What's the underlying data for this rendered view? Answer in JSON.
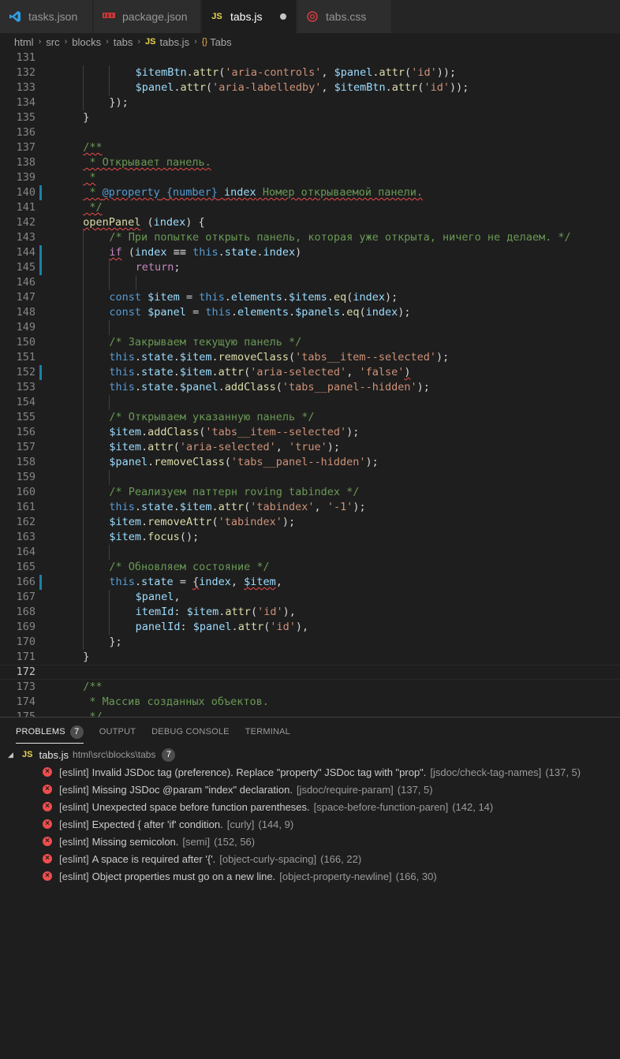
{
  "tabs": [
    {
      "label": "tasks.json",
      "icon": "vscode-icon",
      "color": "#2f9fe4"
    },
    {
      "label": "package.json",
      "icon": "npm-icon",
      "color": "#cb3837"
    },
    {
      "label": "tabs.js",
      "icon": "js-icon",
      "icon_text": "JS",
      "color": "#e8d44d",
      "active": true,
      "modified": true
    },
    {
      "label": "tabs.css",
      "icon": "css-icon",
      "color": "#cc3e44"
    }
  ],
  "breadcrumb": {
    "items": [
      "html",
      "src",
      "blocks",
      "tabs"
    ],
    "file": "tabs.js",
    "file_icon": "JS",
    "symbol": "Tabs",
    "symbol_icon": "{}"
  },
  "editor": {
    "lines": [
      {
        "n": "131",
        "i": 0,
        "t": [
          [
            "",
            ""
          ]
        ]
      },
      {
        "n": "132",
        "i": 3,
        "t": [
          [
            "vr",
            "$itemBtn"
          ],
          [
            "pl",
            "."
          ],
          [
            "fn",
            "attr"
          ],
          [
            "pl",
            "("
          ],
          [
            "st",
            "'aria-controls'"
          ],
          [
            "pl",
            ", "
          ],
          [
            "vr",
            "$panel"
          ],
          [
            "pl",
            "."
          ],
          [
            "fn",
            "attr"
          ],
          [
            "pl",
            "("
          ],
          [
            "st",
            "'id'"
          ],
          [
            "pl",
            "));"
          ]
        ]
      },
      {
        "n": "133",
        "i": 3,
        "t": [
          [
            "vr",
            "$panel"
          ],
          [
            "pl",
            "."
          ],
          [
            "fn",
            "attr"
          ],
          [
            "pl",
            "("
          ],
          [
            "st",
            "'aria-labelledby'"
          ],
          [
            "pl",
            ", "
          ],
          [
            "vr",
            "$itemBtn"
          ],
          [
            "pl",
            "."
          ],
          [
            "fn",
            "attr"
          ],
          [
            "pl",
            "("
          ],
          [
            "st",
            "'id'"
          ],
          [
            "pl",
            "));"
          ]
        ]
      },
      {
        "n": "134",
        "i": 2,
        "t": [
          [
            "pl",
            "});"
          ]
        ]
      },
      {
        "n": "135",
        "i": 1,
        "t": [
          [
            "pl",
            "}"
          ]
        ]
      },
      {
        "n": "136",
        "i": 0,
        "t": [
          [
            "",
            ""
          ]
        ]
      },
      {
        "n": "137",
        "i": 1,
        "t": [
          [
            "cm wv",
            "/**"
          ]
        ]
      },
      {
        "n": "138",
        "i": 1,
        "t": [
          [
            "cm wv",
            " * Открывает панель."
          ]
        ]
      },
      {
        "n": "139",
        "i": 1,
        "t": [
          [
            "cm wv",
            " *"
          ]
        ]
      },
      {
        "n": "140",
        "i": 1,
        "g": true,
        "t": [
          [
            "cm wv",
            " * "
          ],
          [
            "tg wv",
            "@property"
          ],
          [
            "cm wv",
            " "
          ],
          [
            "tg wv",
            "{number}"
          ],
          [
            "cm wv",
            " "
          ],
          [
            "vr wv",
            "index"
          ],
          [
            "cm wv",
            " Номер открываемой панели."
          ]
        ]
      },
      {
        "n": "141",
        "i": 1,
        "t": [
          [
            "cm wv",
            " */"
          ]
        ]
      },
      {
        "n": "142",
        "i": 1,
        "t": [
          [
            "fn wv",
            "openPanel"
          ],
          [
            "pl",
            " ("
          ],
          [
            "vr",
            "index"
          ],
          [
            "pl",
            ") {"
          ]
        ]
      },
      {
        "n": "143",
        "i": 2,
        "t": [
          [
            "cm",
            "/* При попытке открыть панель, которая уже открыта, ничего не делаем. */"
          ]
        ]
      },
      {
        "n": "144",
        "i": 2,
        "g": true,
        "t": [
          [
            "ctl wv",
            "if"
          ],
          [
            "pl",
            " ("
          ],
          [
            "vr",
            "index"
          ],
          [
            "pl",
            " ≡≡ "
          ],
          [
            "kw",
            "this"
          ],
          [
            "pl",
            "."
          ],
          [
            "vr",
            "state"
          ],
          [
            "pl",
            "."
          ],
          [
            "vr",
            "index"
          ],
          [
            "pl",
            ")"
          ]
        ]
      },
      {
        "n": "145",
        "i": 3,
        "g": true,
        "t": [
          [
            "ctl",
            "return"
          ],
          [
            "pl",
            ";"
          ]
        ]
      },
      {
        "n": "146",
        "i": 3,
        "t": [
          [
            "",
            ""
          ]
        ]
      },
      {
        "n": "147",
        "i": 2,
        "t": [
          [
            "kw",
            "const"
          ],
          [
            "pl",
            " "
          ],
          [
            "vr",
            "$item"
          ],
          [
            "pl",
            " = "
          ],
          [
            "kw",
            "this"
          ],
          [
            "pl",
            "."
          ],
          [
            "vr",
            "elements"
          ],
          [
            "pl",
            "."
          ],
          [
            "vr",
            "$items"
          ],
          [
            "pl",
            "."
          ],
          [
            "fn",
            "eq"
          ],
          [
            "pl",
            "("
          ],
          [
            "vr",
            "index"
          ],
          [
            "pl",
            ");"
          ]
        ]
      },
      {
        "n": "148",
        "i": 2,
        "t": [
          [
            "kw",
            "const"
          ],
          [
            "pl",
            " "
          ],
          [
            "vr",
            "$panel"
          ],
          [
            "pl",
            " = "
          ],
          [
            "kw",
            "this"
          ],
          [
            "pl",
            "."
          ],
          [
            "vr",
            "elements"
          ],
          [
            "pl",
            "."
          ],
          [
            "vr",
            "$panels"
          ],
          [
            "pl",
            "."
          ],
          [
            "fn",
            "eq"
          ],
          [
            "pl",
            "("
          ],
          [
            "vr",
            "index"
          ],
          [
            "pl",
            ");"
          ]
        ]
      },
      {
        "n": "149",
        "i": 2,
        "t": [
          [
            "",
            ""
          ]
        ]
      },
      {
        "n": "150",
        "i": 2,
        "t": [
          [
            "cm",
            "/* Закрываем текущую панель */"
          ]
        ]
      },
      {
        "n": "151",
        "i": 2,
        "t": [
          [
            "kw",
            "this"
          ],
          [
            "pl",
            "."
          ],
          [
            "vr",
            "state"
          ],
          [
            "pl",
            "."
          ],
          [
            "vr",
            "$item"
          ],
          [
            "pl",
            "."
          ],
          [
            "fn",
            "removeClass"
          ],
          [
            "pl",
            "("
          ],
          [
            "st",
            "'tabs__item--selected'"
          ],
          [
            "pl",
            ");"
          ]
        ]
      },
      {
        "n": "152",
        "i": 2,
        "g": true,
        "t": [
          [
            "kw",
            "this"
          ],
          [
            "pl",
            "."
          ],
          [
            "vr",
            "state"
          ],
          [
            "pl",
            "."
          ],
          [
            "vr",
            "$item"
          ],
          [
            "pl",
            "."
          ],
          [
            "fn",
            "attr"
          ],
          [
            "pl",
            "("
          ],
          [
            "st",
            "'aria-selected'"
          ],
          [
            "pl",
            ", "
          ],
          [
            "st",
            "'false'"
          ],
          [
            "pl wv",
            ")"
          ]
        ]
      },
      {
        "n": "153",
        "i": 2,
        "t": [
          [
            "kw",
            "this"
          ],
          [
            "pl",
            "."
          ],
          [
            "vr",
            "state"
          ],
          [
            "pl",
            "."
          ],
          [
            "vr",
            "$panel"
          ],
          [
            "pl",
            "."
          ],
          [
            "fn",
            "addClass"
          ],
          [
            "pl",
            "("
          ],
          [
            "st",
            "'tabs__panel--hidden'"
          ],
          [
            "pl",
            ");"
          ]
        ]
      },
      {
        "n": "154",
        "i": 2,
        "t": [
          [
            "",
            ""
          ]
        ]
      },
      {
        "n": "155",
        "i": 2,
        "t": [
          [
            "cm",
            "/* Открываем указанную панель */"
          ]
        ]
      },
      {
        "n": "156",
        "i": 2,
        "t": [
          [
            "vr",
            "$item"
          ],
          [
            "pl",
            "."
          ],
          [
            "fn",
            "addClass"
          ],
          [
            "pl",
            "("
          ],
          [
            "st",
            "'tabs__item--selected'"
          ],
          [
            "pl",
            ");"
          ]
        ]
      },
      {
        "n": "157",
        "i": 2,
        "t": [
          [
            "vr",
            "$item"
          ],
          [
            "pl",
            "."
          ],
          [
            "fn",
            "attr"
          ],
          [
            "pl",
            "("
          ],
          [
            "st",
            "'aria-selected'"
          ],
          [
            "pl",
            ", "
          ],
          [
            "st",
            "'true'"
          ],
          [
            "pl",
            ");"
          ]
        ]
      },
      {
        "n": "158",
        "i": 2,
        "t": [
          [
            "vr",
            "$panel"
          ],
          [
            "pl",
            "."
          ],
          [
            "fn",
            "removeClass"
          ],
          [
            "pl",
            "("
          ],
          [
            "st",
            "'tabs__panel--hidden'"
          ],
          [
            "pl",
            ");"
          ]
        ]
      },
      {
        "n": "159",
        "i": 2,
        "t": [
          [
            "",
            ""
          ]
        ]
      },
      {
        "n": "160",
        "i": 2,
        "t": [
          [
            "cm",
            "/* Реализуем паттерн roving tabindex */"
          ]
        ]
      },
      {
        "n": "161",
        "i": 2,
        "t": [
          [
            "kw",
            "this"
          ],
          [
            "pl",
            "."
          ],
          [
            "vr",
            "state"
          ],
          [
            "pl",
            "."
          ],
          [
            "vr",
            "$item"
          ],
          [
            "pl",
            "."
          ],
          [
            "fn",
            "attr"
          ],
          [
            "pl",
            "("
          ],
          [
            "st",
            "'tabindex'"
          ],
          [
            "pl",
            ", "
          ],
          [
            "st",
            "'-1'"
          ],
          [
            "pl",
            ");"
          ]
        ]
      },
      {
        "n": "162",
        "i": 2,
        "t": [
          [
            "vr",
            "$item"
          ],
          [
            "pl",
            "."
          ],
          [
            "fn",
            "removeAttr"
          ],
          [
            "pl",
            "("
          ],
          [
            "st",
            "'tabindex'"
          ],
          [
            "pl",
            ");"
          ]
        ]
      },
      {
        "n": "163",
        "i": 2,
        "t": [
          [
            "vr",
            "$item"
          ],
          [
            "pl",
            "."
          ],
          [
            "fn",
            "focus"
          ],
          [
            "pl",
            "();"
          ]
        ]
      },
      {
        "n": "164",
        "i": 2,
        "t": [
          [
            "",
            ""
          ]
        ]
      },
      {
        "n": "165",
        "i": 2,
        "t": [
          [
            "cm",
            "/* Обновляем состояние */"
          ]
        ]
      },
      {
        "n": "166",
        "i": 2,
        "g": true,
        "t": [
          [
            "kw",
            "this"
          ],
          [
            "pl",
            "."
          ],
          [
            "vr",
            "state"
          ],
          [
            "pl",
            " = "
          ],
          [
            "pl wv",
            "{"
          ],
          [
            "vr",
            "index"
          ],
          [
            "pl",
            ", "
          ],
          [
            "vr wv",
            "$item"
          ],
          [
            "pl",
            ","
          ]
        ]
      },
      {
        "n": "167",
        "i": 3,
        "t": [
          [
            "vr",
            "$panel"
          ],
          [
            "pl",
            ","
          ]
        ]
      },
      {
        "n": "168",
        "i": 3,
        "t": [
          [
            "vr",
            "itemId"
          ],
          [
            "pl",
            ": "
          ],
          [
            "vr",
            "$item"
          ],
          [
            "pl",
            "."
          ],
          [
            "fn",
            "attr"
          ],
          [
            "pl",
            "("
          ],
          [
            "st",
            "'id'"
          ],
          [
            "pl",
            "),"
          ]
        ]
      },
      {
        "n": "169",
        "i": 3,
        "t": [
          [
            "vr",
            "panelId"
          ],
          [
            "pl",
            ": "
          ],
          [
            "vr",
            "$panel"
          ],
          [
            "pl",
            "."
          ],
          [
            "fn",
            "attr"
          ],
          [
            "pl",
            "("
          ],
          [
            "st",
            "'id'"
          ],
          [
            "pl",
            "),"
          ]
        ]
      },
      {
        "n": "170",
        "i": 2,
        "t": [
          [
            "pl",
            "};"
          ]
        ]
      },
      {
        "n": "171",
        "i": 1,
        "t": [
          [
            "pl",
            "}"
          ]
        ]
      },
      {
        "n": "172",
        "i": 0,
        "current": true,
        "t": [
          [
            "",
            ""
          ]
        ]
      },
      {
        "n": "173",
        "i": 1,
        "t": [
          [
            "cm",
            "/**"
          ]
        ]
      },
      {
        "n": "174",
        "i": 1,
        "t": [
          [
            "cm",
            " * Массив созданных объектов."
          ]
        ]
      },
      {
        "n": "175",
        "i": 1,
        "t": [
          [
            "cm",
            " */"
          ]
        ]
      }
    ]
  },
  "panel": {
    "tabs": [
      {
        "label": "PROBLEMS",
        "active": true,
        "badge": "7"
      },
      {
        "label": "OUTPUT"
      },
      {
        "label": "DEBUG CONSOLE"
      },
      {
        "label": "TERMINAL"
      }
    ],
    "file": {
      "icon": "JS",
      "name": "tabs.js",
      "path": "html\\src\\blocks\\tabs",
      "count": "7"
    },
    "problems": [
      {
        "source": "[eslint]",
        "message": "Invalid JSDoc tag (preference). Replace \"property\" JSDoc tag with \"prop\".",
        "rule": "[jsdoc/check-tag-names]",
        "location": "(137, 5)"
      },
      {
        "source": "[eslint]",
        "message": "Missing JSDoc @param \"index\" declaration.",
        "rule": "[jsdoc/require-param]",
        "location": "(137, 5)"
      },
      {
        "source": "[eslint]",
        "message": "Unexpected space before function parentheses.",
        "rule": "[space-before-function-paren]",
        "location": "(142, 14)"
      },
      {
        "source": "[eslint]",
        "message": "Expected { after 'if' condition.",
        "rule": "[curly]",
        "location": "(144, 9)"
      },
      {
        "source": "[eslint]",
        "message": "Missing semicolon.",
        "rule": "[semi]",
        "location": "(152, 56)"
      },
      {
        "source": "[eslint]",
        "message": "A space is required after '{'.",
        "rule": "[object-curly-spacing]",
        "location": "(166, 22)"
      },
      {
        "source": "[eslint]",
        "message": "Object properties must go on a new line.",
        "rule": "[object-property-newline]",
        "location": "(166, 30)"
      }
    ]
  }
}
